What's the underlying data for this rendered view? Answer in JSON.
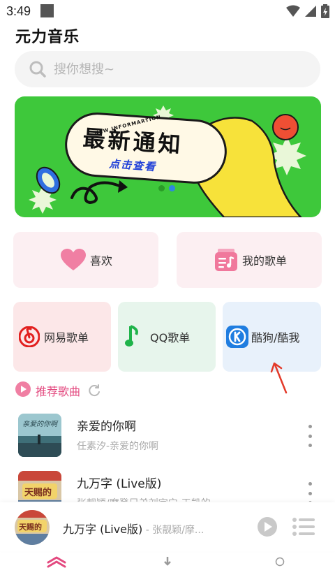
{
  "status_bar": {
    "time": "3:49"
  },
  "app": {
    "title": "元力音乐"
  },
  "search": {
    "placeholder": "搜你想搜~"
  },
  "banner": {
    "title": "最新通知",
    "subtitle": "点击查看",
    "tag": "NEW INFORMARTION",
    "dots": 2,
    "active_dot": 1
  },
  "quick": {
    "like_label": "喜欢",
    "my_playlist_label": "我的歌单"
  },
  "sources": {
    "netease_label": "网易歌单",
    "qq_label": "QQ歌单",
    "kugou_label": "酷狗/酷我"
  },
  "section": {
    "title": "推荐歌曲"
  },
  "songs": [
    {
      "title": "亲爱的你啊",
      "subtitle": "任素汐-亲爱的你啊"
    },
    {
      "title": "九万字 (Live版)",
      "subtitle": "张靓颖/摩登兄弟刘宇宁-王凯的..."
    }
  ],
  "player": {
    "title": "九万字 (Live版)",
    "artist": " - 张靓颖/摩..."
  },
  "colors": {
    "accent": "#e3497f",
    "banner_bg": "#3ec83b",
    "netease": "#e2201f",
    "qq": "#1fb34a",
    "kugou": "#1f7de0"
  }
}
